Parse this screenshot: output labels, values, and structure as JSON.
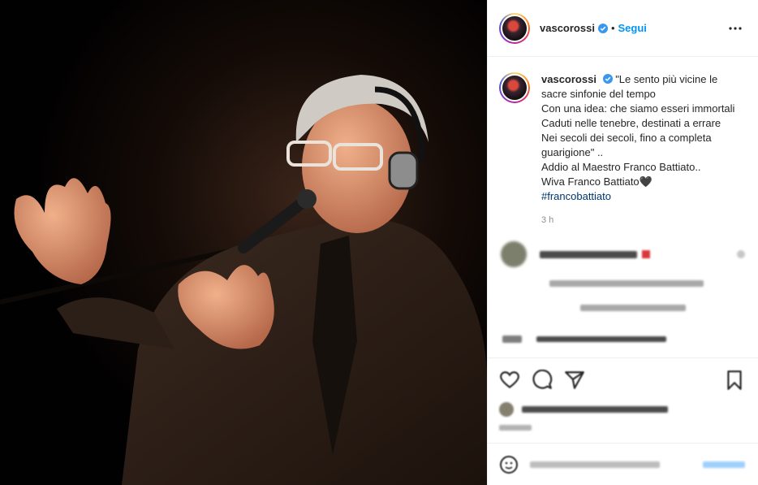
{
  "post": {
    "username": "vascorossi",
    "verified": true,
    "follow_label": "Segui",
    "separator": "•",
    "caption_lines": [
      "\"Le sento più vicine le sacre sinfonie del tempo",
      "Con una idea: che siamo esseri immortali",
      "Caduti nelle tenebre, destinati a errare",
      "Nei secoli dei secoli, fino a completa guarigione\" ..",
      "Addio al Maestro Franco Battiato..",
      "Wiva Franco Battiato🖤"
    ],
    "hashtag": "#francobattiato",
    "timestamp": "3 h"
  },
  "icons": {
    "more": "more-options-icon",
    "verified": "verified-badge-icon",
    "like": "heart-icon",
    "comment": "comment-icon",
    "share": "share-icon",
    "save": "bookmark-icon",
    "emoji": "emoji-icon"
  },
  "colors": {
    "accent": "#0095f6",
    "hashtag": "#00376b",
    "muted": "#8e8e8e",
    "border": "#efefef"
  }
}
